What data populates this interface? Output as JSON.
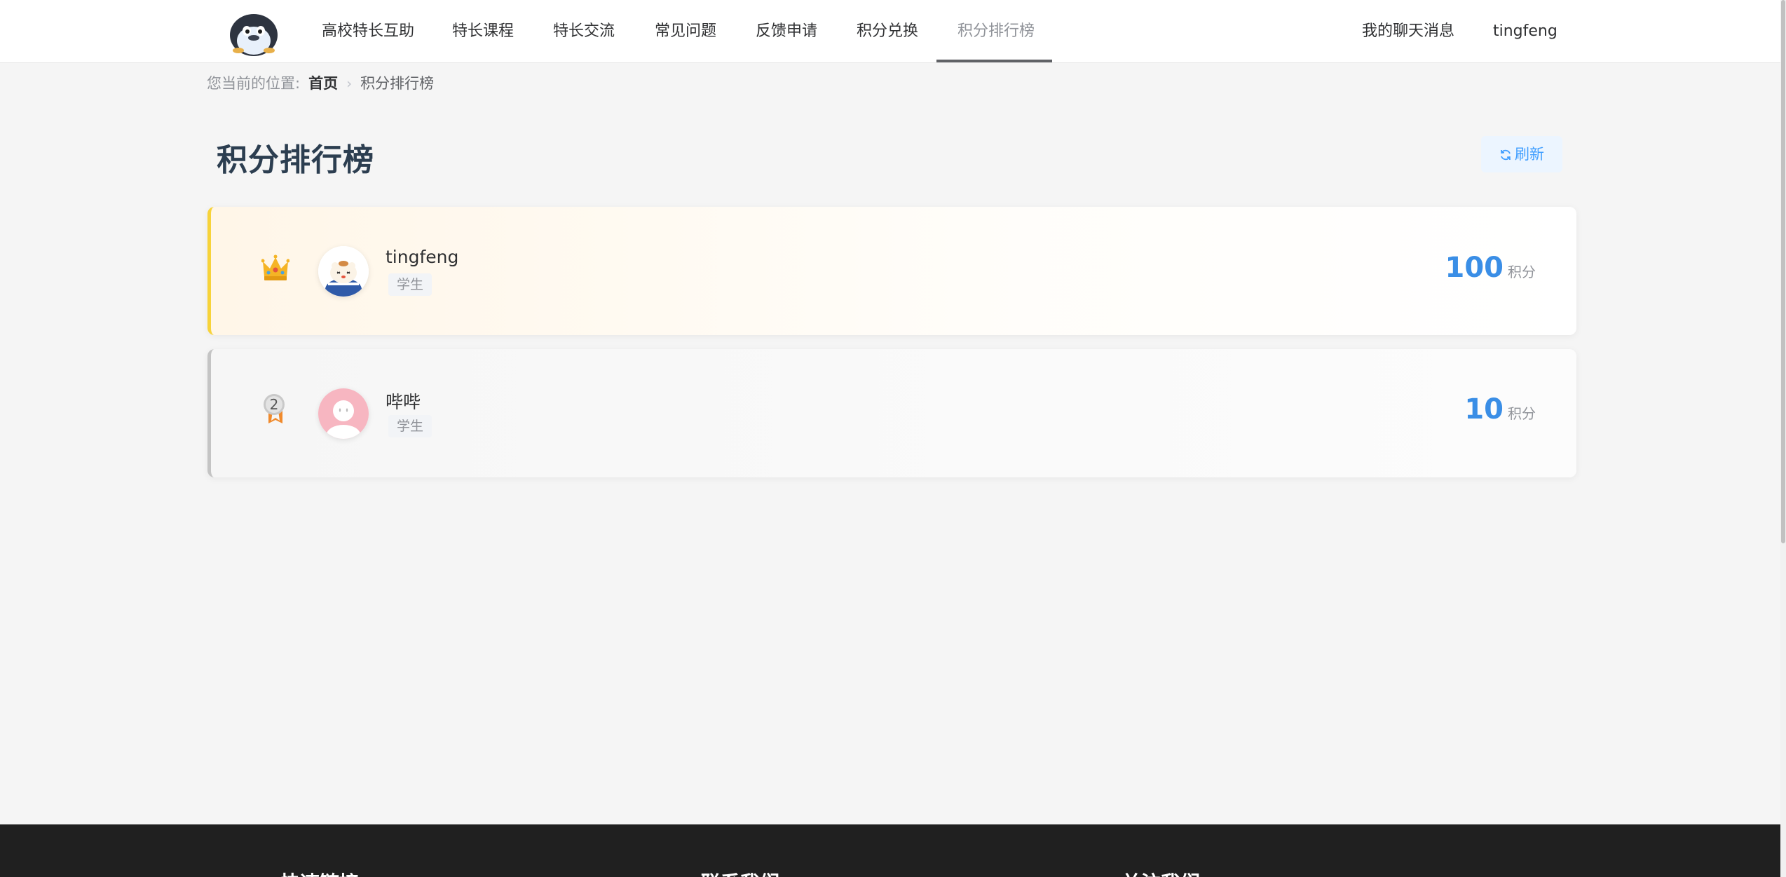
{
  "header": {
    "logo_icon": "penguin-logo",
    "nav": [
      {
        "label": "高校特长互助"
      },
      {
        "label": "特长课程"
      },
      {
        "label": "特长交流"
      },
      {
        "label": "常见问题"
      },
      {
        "label": "反馈申请"
      },
      {
        "label": "积分兑换"
      },
      {
        "label": "积分排行榜",
        "active": true
      }
    ],
    "messages_label": "我的聊天消息",
    "username": "tingfeng"
  },
  "breadcrumb": {
    "prefix": "您当前的位置:",
    "home": "首页",
    "current": "积分排行榜"
  },
  "page": {
    "title": "积分排行榜",
    "refresh_label": "刷新",
    "refresh_icon": "refresh-icon"
  },
  "ranking": [
    {
      "rank": 1,
      "badge_icon": "crown-icon",
      "name": "tingfeng",
      "role": "学生",
      "score": "100",
      "unit": "积分",
      "accent": "#f7d33a"
    },
    {
      "rank": 2,
      "badge_icon": "silver-medal-icon",
      "badge_text": "2",
      "name": "哔哔",
      "role": "学生",
      "score": "10",
      "unit": "积分",
      "accent": "#c4c4c4"
    }
  ],
  "footer": {
    "columns": [
      "快速链接",
      "联系我们",
      "关注我们"
    ]
  },
  "colors": {
    "primary": "#3a8ee6",
    "refresh_bg": "#ecf5ff",
    "footer_bg": "#202020",
    "page_bg": "#f5f5f5"
  }
}
